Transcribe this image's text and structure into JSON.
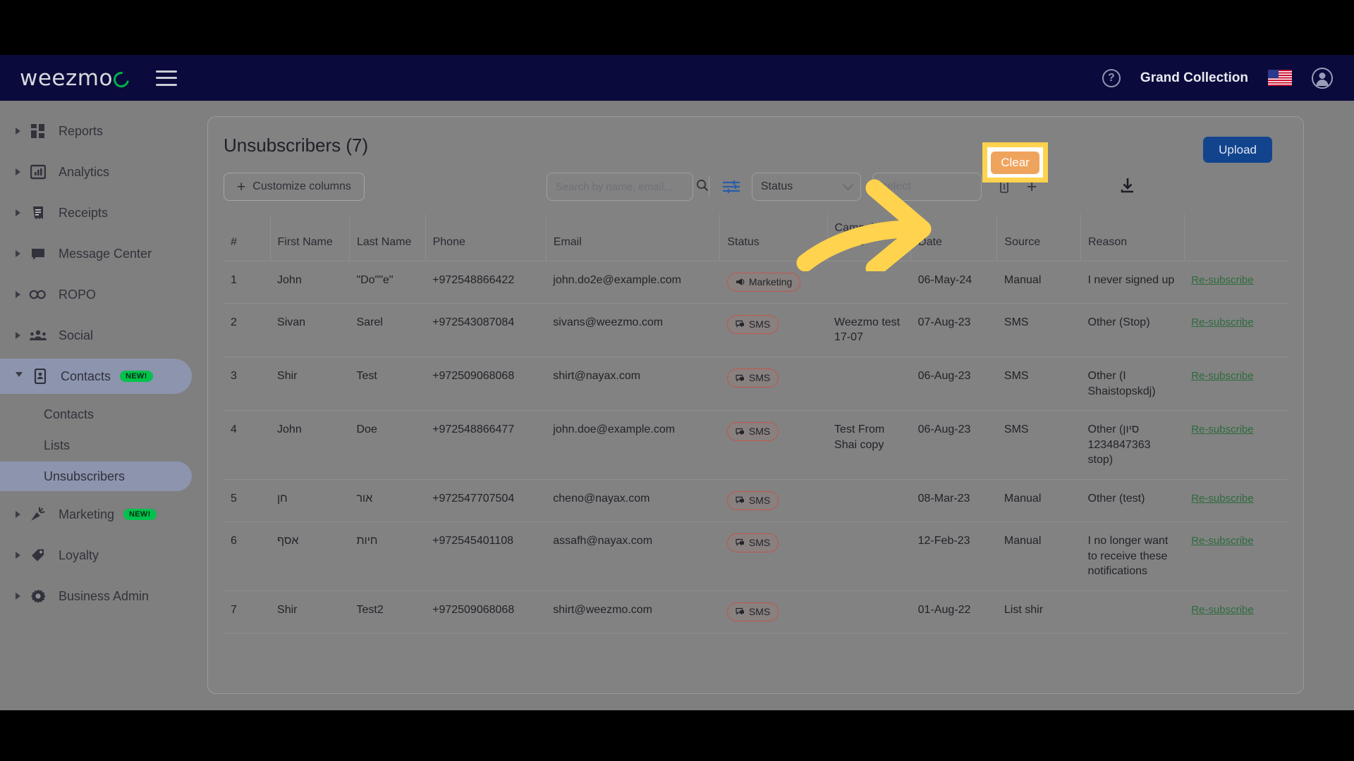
{
  "topbar": {
    "logo_text": "weezmo",
    "account_name": "Grand Collection",
    "help_icon": "question-mark-icon",
    "flag_icon": "us-flag-icon",
    "user_icon": "account-circle-icon",
    "menu_icon": "hamburger-menu-icon"
  },
  "sidebar": {
    "items": [
      {
        "label": "Reports",
        "icon": "dashboard-icon",
        "badge": "",
        "expanded": false,
        "active": false
      },
      {
        "label": "Analytics",
        "icon": "bar-chart-icon",
        "badge": "",
        "expanded": false,
        "active": false
      },
      {
        "label": "Receipts",
        "icon": "receipt-icon",
        "badge": "",
        "expanded": false,
        "active": false
      },
      {
        "label": "Message Center",
        "icon": "chat-bubble-icon",
        "badge": "",
        "expanded": false,
        "active": false
      },
      {
        "label": "ROPO",
        "icon": "infinity-icon",
        "badge": "",
        "expanded": false,
        "active": false
      },
      {
        "label": "Social",
        "icon": "people-group-icon",
        "badge": "",
        "expanded": false,
        "active": false
      },
      {
        "label": "Contacts",
        "icon": "contact-card-icon",
        "badge": "NEW!",
        "expanded": true,
        "active": true
      },
      {
        "label": "Marketing",
        "icon": "megaphone-cone-icon",
        "badge": "NEW!",
        "expanded": false,
        "active": false
      },
      {
        "label": "Loyalty",
        "icon": "tag-icon",
        "badge": "",
        "expanded": false,
        "active": false
      },
      {
        "label": "Business Admin",
        "icon": "gear-icon",
        "badge": "",
        "expanded": false,
        "active": false
      }
    ],
    "sub_items": [
      {
        "label": "Contacts",
        "active": false
      },
      {
        "label": "Lists",
        "active": false
      },
      {
        "label": "Unsubscribers",
        "active": true
      }
    ]
  },
  "main": {
    "page_title": "Unsubscribers (7)",
    "toolbar": {
      "customize_columns_label": "Customize columns",
      "customize_columns_icon": "plus-icon",
      "search_placeholder": "Search by name, email,...",
      "search_value": "",
      "search_icon": "search-icon",
      "filter_icon": "filter-sliders-icon",
      "status_select_value": "Status",
      "select_placeholder": "select",
      "select_value": "",
      "delete_icon": "trash-can-icon",
      "add_icon": "plus-icon",
      "clear_label": "Clear",
      "download_icon": "download-icon",
      "upload_label": "Upload"
    },
    "table": {
      "headers": [
        "#",
        "First Name",
        "Last Name",
        "Phone",
        "Email",
        "Status",
        "Campaign Name",
        "Date",
        "Source",
        "Reason",
        ""
      ],
      "action_label": "Re-subscribe",
      "rows": [
        {
          "num": "1",
          "first": "John",
          "last": "\"Do\"\"e\"",
          "phone": "+972548866422",
          "email": "john.do2e@example.com",
          "status": "Marketing",
          "status_icon": "megaphone-icon",
          "campaign": "",
          "date": "06-May-24",
          "source": "Manual",
          "reason": "I never signed up"
        },
        {
          "num": "2",
          "first": "Sivan",
          "last": "Sarel",
          "phone": "+972543087084",
          "email": "sivans@weezmo.com",
          "status": "SMS",
          "status_icon": "sms-icon",
          "campaign": "Weezmo test 17-07",
          "date": "07-Aug-23",
          "source": "SMS",
          "reason": "Other (Stop)"
        },
        {
          "num": "3",
          "first": "Shir",
          "last": "Test",
          "phone": "+972509068068",
          "email": "shirt@nayax.com",
          "status": "SMS",
          "status_icon": "sms-icon",
          "campaign": "",
          "date": "06-Aug-23",
          "source": "SMS",
          "reason": "Other (I Shaistopskdj)"
        },
        {
          "num": "4",
          "first": "John",
          "last": "Doe",
          "phone": "+972548866477",
          "email": "john.doe@example.com",
          "status": "SMS",
          "status_icon": "sms-icon",
          "campaign": "Test From Shai copy",
          "date": "06-Aug-23",
          "source": "SMS",
          "reason": "Other (סיון 1234847363 stop)"
        },
        {
          "num": "5",
          "first": "חן",
          "last": "אור",
          "phone": "+972547707504",
          "email": "cheno@nayax.com",
          "status": "SMS",
          "status_icon": "sms-icon",
          "campaign": "",
          "date": "08-Mar-23",
          "source": "Manual",
          "reason": "Other (test)"
        },
        {
          "num": "6",
          "first": "אסף",
          "last": "חיות",
          "phone": "+972545401108",
          "email": "assafh@nayax.com",
          "status": "SMS",
          "status_icon": "sms-icon",
          "campaign": "",
          "date": "12-Feb-23",
          "source": "Manual",
          "reason": "I no longer want to receive these notifications"
        },
        {
          "num": "7",
          "first": "Shir",
          "last": "Test2",
          "phone": "+972509068068",
          "email": "shirt@weezmo.com",
          "status": "SMS",
          "status_icon": "sms-icon",
          "campaign": "",
          "date": "01-Aug-22",
          "source": "List shir",
          "reason": ""
        }
      ]
    }
  },
  "annotation": {
    "arrow_icon": "curved-arrow-right-icon",
    "highlight_target": "clear-button",
    "arrow_color": "#ffd34d",
    "highlight_color": "#ffd34d"
  }
}
